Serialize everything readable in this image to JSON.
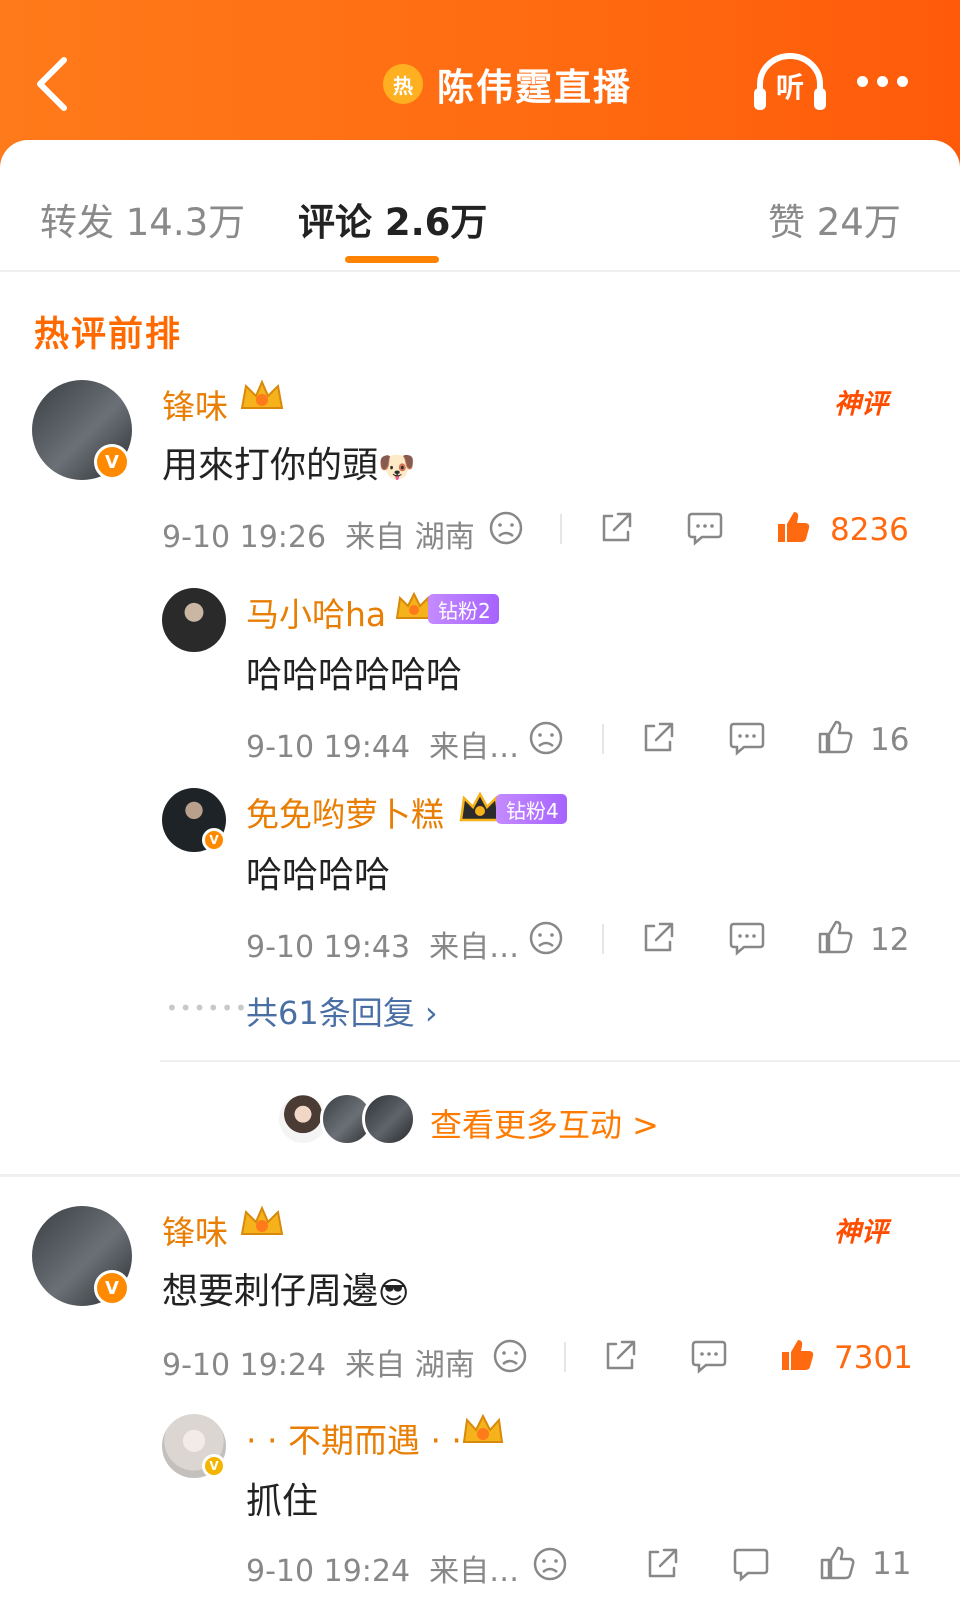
{
  "header": {
    "title": "陈伟霆直播",
    "fire_badge": "热",
    "listen_label": "听",
    "accent": "#ff6a10"
  },
  "tabs": {
    "repost": "转发 14.3万",
    "comments": "评论 2.6万",
    "likes": "赞 24万"
  },
  "section_title": "热评前排",
  "comments": [
    {
      "user": "锋味",
      "text": "用來打你的頭",
      "emoji": "🐶",
      "tag": "神评",
      "time": "9-10 19:26",
      "location": "来自 湖南",
      "likes": "8236",
      "replies": [
        {
          "user": "马小哈ha",
          "fan_badge": "钻粉2",
          "text": "哈哈哈哈哈哈",
          "time": "9-10 19:44",
          "location": "来自…",
          "likes": "16"
        },
        {
          "user": "免免哟萝卜糕",
          "fan_badge": "钻粉4",
          "text": "哈哈哈哈",
          "time": "9-10 19:43",
          "location": "来自…",
          "likes": "12"
        }
      ],
      "more_replies": "共61条回复",
      "interactions": "查看更多互动 >"
    },
    {
      "user": "锋味",
      "text": "想要刺仔周邊",
      "emoji": "😎",
      "tag": "神评",
      "time": "9-10 19:24",
      "location": "来自 湖南",
      "likes": "7301",
      "replies": [
        {
          "user": "· · 不期而遇 · ·",
          "text": "抓住",
          "time": "9-10 19:24",
          "location": "来自…",
          "likes": "11"
        }
      ]
    }
  ],
  "icons": {
    "back": "back-arrow-icon",
    "listen": "headphones-icon",
    "more": "more-dots-icon",
    "dislike": "sad-face-icon",
    "share": "share-icon",
    "reply": "comment-bubble-icon",
    "like": "thumbs-up-icon"
  }
}
